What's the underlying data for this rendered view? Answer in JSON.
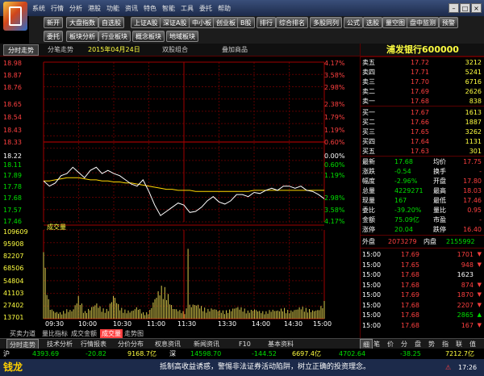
{
  "menu": [
    "系统",
    "行情",
    "分析",
    "港股",
    "功能",
    "资讯",
    "特色",
    "智能",
    "工具",
    "委托",
    "帮助"
  ],
  "toolbar1": [
    "新开",
    "大盘指数",
    "自选股",
    "上证A股",
    "深证A股",
    "中小板",
    "创业板",
    "B股",
    "排行",
    "综合排名",
    "多股同列",
    "公式",
    "选股",
    "量空图",
    "盘中监测",
    "预警"
  ],
  "toolbar2": [
    "委托",
    "板块分析",
    "行业板块",
    "概念板块",
    "地域板块"
  ],
  "tabs": {
    "t1": "分时走势",
    "t2": "分笔走势",
    "date": "2015年04月24日",
    "t3": "双股组合",
    "t4": "叠加商品"
  },
  "stock": {
    "name": "浦发银行",
    "code": "600000"
  },
  "chart": {
    "left_labels": [
      "18.98",
      "18.87",
      "18.76",
      "18.65",
      "18.54",
      "18.43",
      "18.33",
      "18.22",
      "18.11",
      "17.89",
      "17.78",
      "17.68",
      "17.57",
      "17.46"
    ],
    "right_labels": [
      "4.17%",
      "3.58%",
      "2.98%",
      "2.38%",
      "1.79%",
      "1.19%",
      "0.60%",
      "0.00%",
      "0.60%",
      "1.19%",
      "2.98%",
      "3.58%",
      "4.17%"
    ],
    "vol_label": "成交量",
    "vol_labels": [
      "109609",
      "95908",
      "82207",
      "68506",
      "54804",
      "41103",
      "27402",
      "13701"
    ],
    "time_labels": [
      "09:30",
      "10:00",
      "10:30",
      "11:00",
      "11:30",
      "13:30",
      "14:00",
      "14:30",
      "15:00"
    ]
  },
  "chart_data": {
    "type": "line",
    "ylim": [
      17.46,
      18.98
    ],
    "preclose": 18.22,
    "price_x_minutes": [
      0,
      5,
      10,
      15,
      20,
      25,
      30,
      35,
      40,
      45,
      50,
      55,
      60,
      65,
      70,
      75,
      80,
      85,
      90,
      95,
      100,
      105,
      110,
      115,
      120,
      125,
      130,
      135,
      140,
      145,
      150,
      155,
      160,
      165,
      170,
      175,
      180,
      185,
      190,
      195,
      200,
      205,
      210,
      215,
      220,
      225,
      230,
      235,
      240
    ],
    "price": [
      17.85,
      17.8,
      17.83,
      17.9,
      17.92,
      17.98,
      17.93,
      17.88,
      17.95,
      17.98,
      17.92,
      17.95,
      17.92,
      17.9,
      17.86,
      17.82,
      17.8,
      17.86,
      17.75,
      17.62,
      17.52,
      17.56,
      17.6,
      17.64,
      17.62,
      17.55,
      17.56,
      17.6,
      17.66,
      17.7,
      17.65,
      17.63,
      17.66,
      17.72,
      17.72,
      17.7,
      17.74,
      17.73,
      17.76,
      17.78,
      17.76,
      17.8,
      17.8,
      17.78,
      17.8,
      17.76,
      17.75,
      17.72,
      17.68
    ],
    "avg": [
      17.85,
      17.85,
      17.86,
      17.87,
      17.88,
      17.88,
      17.88,
      17.87,
      17.86,
      17.86,
      17.85,
      17.85,
      17.84,
      17.84,
      17.83,
      17.83,
      17.82,
      17.81,
      17.8,
      17.79,
      17.78,
      17.77,
      17.77,
      17.76,
      17.76,
      17.76,
      17.75,
      17.75,
      17.75,
      17.75,
      17.75,
      17.75,
      17.75,
      17.75,
      17.75,
      17.75,
      17.76,
      17.76,
      17.76,
      17.76,
      17.76,
      17.76,
      17.76,
      17.76,
      17.76,
      17.76,
      17.76,
      17.76,
      17.76
    ],
    "volume_ylim": [
      0,
      109609
    ],
    "volume": [
      82207,
      15000,
      9000,
      8000,
      12000,
      11000,
      30000,
      9000,
      14000,
      21000,
      13000,
      12000,
      33000,
      15000,
      11000,
      10000,
      16000,
      8000,
      8000,
      27000,
      42000,
      38000,
      15000,
      12000,
      9000,
      18000,
      20000,
      16000,
      12000,
      14000,
      11000,
      10000,
      12000,
      16000,
      14000,
      10000,
      13000,
      10000,
      9000,
      12000,
      11000,
      14000,
      10000,
      12000,
      16000,
      13000,
      11000,
      12000,
      22000
    ]
  },
  "quote": {
    "asks": [
      {
        "label": "卖五",
        "price": "17.72",
        "vol": "3212"
      },
      {
        "label": "卖四",
        "price": "17.71",
        "vol": "5241"
      },
      {
        "label": "卖三",
        "price": "17.70",
        "vol": "6716"
      },
      {
        "label": "卖二",
        "price": "17.69",
        "vol": "2626"
      },
      {
        "label": "卖一",
        "price": "17.68",
        "vol": "838"
      }
    ],
    "bids": [
      {
        "label": "买一",
        "price": "17.67",
        "vol": "1613"
      },
      {
        "label": "买二",
        "price": "17.66",
        "vol": "1887"
      },
      {
        "label": "买三",
        "price": "17.65",
        "vol": "3262"
      },
      {
        "label": "买四",
        "price": "17.64",
        "vol": "1131"
      },
      {
        "label": "买五",
        "price": "17.63",
        "vol": "301"
      }
    ],
    "stats": [
      {
        "l1": "最新",
        "v1": "17.68",
        "l2": "均价",
        "v2": "17.75"
      },
      {
        "l1": "涨跌",
        "v1": "-0.54",
        "l2": "换手",
        "v2": "-"
      },
      {
        "l1": "幅度",
        "v1": "-2.96%",
        "l2": "开盘",
        "v2": "17.80"
      },
      {
        "l1": "总量",
        "v1": "4229271",
        "l2": "最高",
        "v2": "18.03"
      },
      {
        "l1": "现量",
        "v1": "167",
        "l2": "最低",
        "v2": "17.46"
      },
      {
        "l1": "委比",
        "v1": "-39.20%",
        "l2": "量比",
        "v2": "0.95"
      },
      {
        "l1": "金额",
        "v1": "75.09亿",
        "l2": "市盈",
        "v2": "-"
      },
      {
        "l1": "涨停",
        "v1": "20.04",
        "l2": "跌停",
        "v2": "16.40"
      }
    ],
    "outer_label": "外盘",
    "outer": "2073279",
    "inner_label": "内盘",
    "inner": "2155992",
    "ticks": [
      {
        "time": "15:00",
        "price": "17.69",
        "vol": "1701",
        "dir": "down"
      },
      {
        "time": "15:00",
        "price": "17.65",
        "vol": "948",
        "dir": "down"
      },
      {
        "time": "15:00",
        "price": "17.68",
        "vol": "1623",
        "dir": "none"
      },
      {
        "time": "15:00",
        "price": "17.68",
        "vol": "874",
        "dir": "down"
      },
      {
        "time": "15:00",
        "price": "17.69",
        "vol": "1870",
        "dir": "down"
      },
      {
        "time": "15:00",
        "price": "17.68",
        "vol": "2207",
        "dir": "down"
      },
      {
        "time": "15:00",
        "price": "17.68",
        "vol": "2865",
        "dir": "up"
      },
      {
        "time": "15:00",
        "price": "17.68",
        "vol": "167",
        "dir": "down"
      }
    ]
  },
  "bottabs": [
    "买卖力道",
    "量比指标",
    "成交金额",
    "成交量",
    "走势图"
  ],
  "tabbar2": [
    "分时走势",
    "技术分析",
    "行情报表",
    "分价分布",
    "权息资讯",
    "新闻资讯",
    "F10",
    "基本资料",
    "细",
    "笔",
    "价",
    "分",
    "盘",
    "势",
    "指",
    "联",
    "值",
    "主"
  ],
  "indexbar": {
    "sh_label": "沪",
    "sh_price": "4393.69",
    "sh_chg": "-20.82",
    "sh_amt": "9168.7亿",
    "sz_label": "深",
    "sz_price": "14598.70",
    "sz_chg": "-144.52",
    "sz_amt": "6697.4亿",
    "cy_price": "4702.64",
    "cy_chg": "-38.25",
    "cy_amt": "7212.7亿"
  },
  "status": {
    "brand": "钱龙",
    "ticker": "抵制高收益诱惑，警惕非法证券活动陷阱，树立正确的投资理念。",
    "time": "17:26"
  }
}
